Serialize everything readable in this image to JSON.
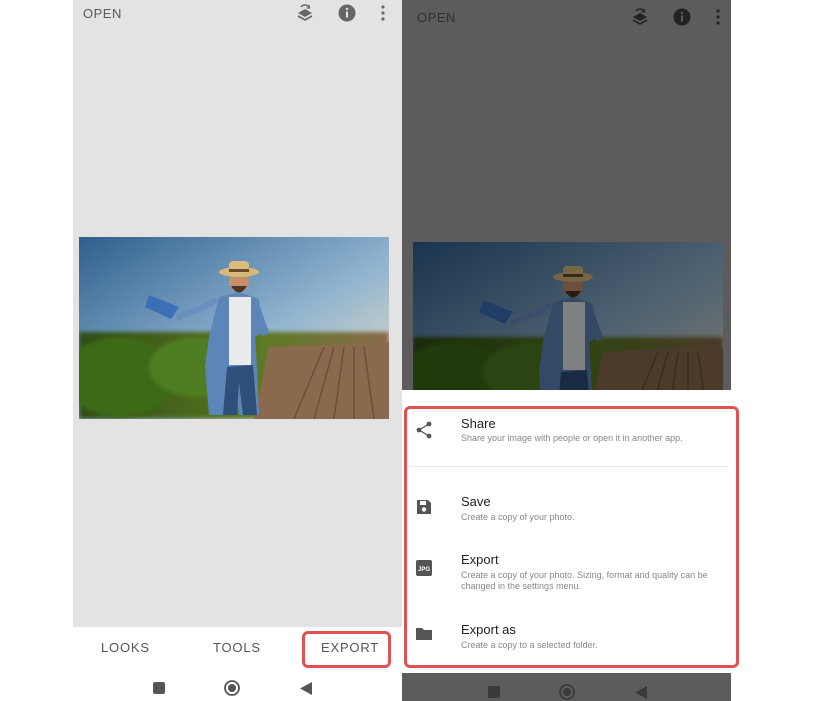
{
  "left": {
    "open_label": "OPEN",
    "tabs": {
      "looks": "LOOKS",
      "tools": "TOOLS",
      "export": "EXPORT"
    }
  },
  "right": {
    "open_label": "OPEN",
    "sheet": {
      "items": [
        {
          "title": "Share",
          "subtitle": "Share your image with people or open it in another app.",
          "icon": "share-icon"
        },
        {
          "title": "Save",
          "subtitle": "Create a copy of your photo.",
          "icon": "save-icon"
        },
        {
          "title": "Export",
          "subtitle": "Create a copy of your photo. Sizing, format and quality can be changed in the settings menu.",
          "icon": "jpg-icon",
          "icon_text": "JPG"
        },
        {
          "title": "Export as",
          "subtitle": "Create a copy to a selected folder.",
          "icon": "folder-icon"
        }
      ]
    }
  },
  "colors": {
    "highlight": "#e05252",
    "dim_overlay": "#5c5c5c",
    "canvas": "#e3e3e3"
  }
}
